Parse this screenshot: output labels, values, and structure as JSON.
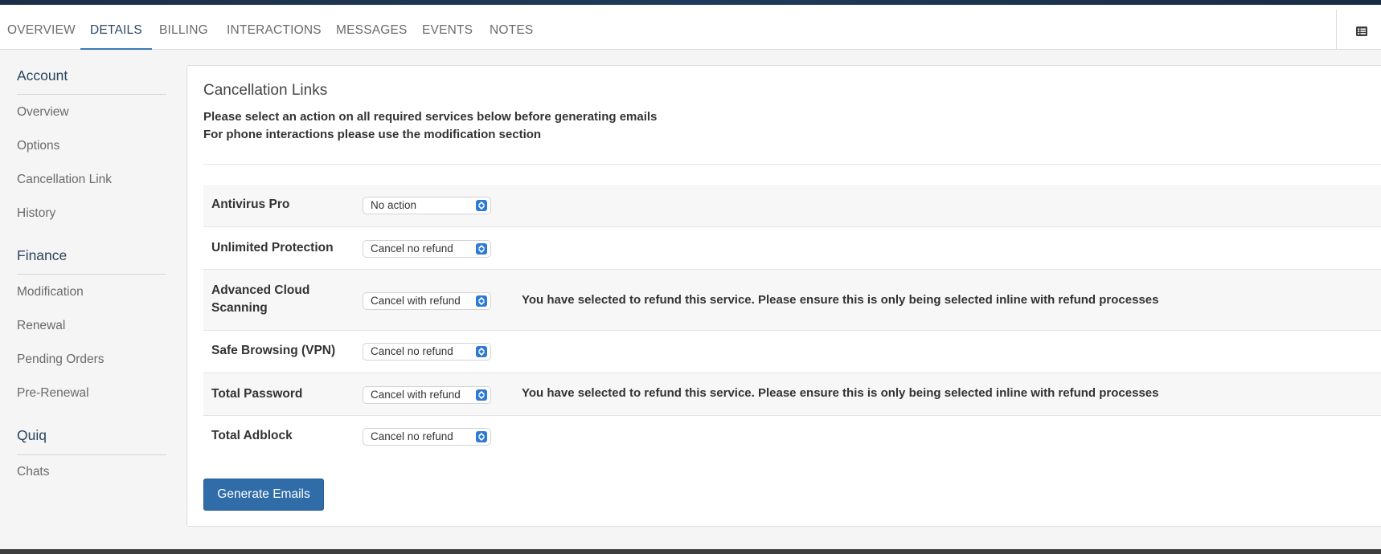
{
  "tabs": {
    "overview": "OVERVIEW",
    "details": "DETAILS",
    "billing": "BILLING",
    "interactions": "INTERACTIONS",
    "messages": "MESSAGES",
    "events": "EVENTS",
    "notes": "NOTES",
    "active": "DETAILS"
  },
  "corner_icon": "list-icon",
  "sidebar": {
    "account": {
      "heading": "Account",
      "items": [
        "Overview",
        "Options",
        "Cancellation Link",
        "History"
      ]
    },
    "finance": {
      "heading": "Finance",
      "items": [
        "Modification",
        "Renewal",
        "Pending Orders",
        "Pre-Renewal"
      ]
    },
    "quiq": {
      "heading": "Quiq",
      "items": [
        "Chats"
      ]
    }
  },
  "panel": {
    "title": "Cancellation Links",
    "instruction_1": "Please select an action on all required services below before generating emails",
    "instruction_2": "For phone interactions please use the modification section",
    "services": [
      {
        "name": "Antivirus Pro",
        "action": "No action",
        "warning": ""
      },
      {
        "name": "Unlimited Protection",
        "action": "Cancel no refund",
        "warning": ""
      },
      {
        "name": "Advanced Cloud Scanning",
        "action": "Cancel with refund",
        "warning": "You have selected to refund this service. Please ensure this is only being selected inline with refund processes"
      },
      {
        "name": "Safe Browsing (VPN)",
        "action": "Cancel no refund",
        "warning": ""
      },
      {
        "name": "Total Password",
        "action": "Cancel with refund",
        "warning": "You have selected to refund this service. Please ensure this is only being selected inline with refund processes"
      },
      {
        "name": "Total Adblock",
        "action": "Cancel no refund",
        "warning": ""
      }
    ],
    "generate_button": "Generate Emails"
  },
  "colors": {
    "accent": "#2f6ca8",
    "select_arrow": "#2d7ad6",
    "active_tab_underline": "#3a7ab5"
  }
}
